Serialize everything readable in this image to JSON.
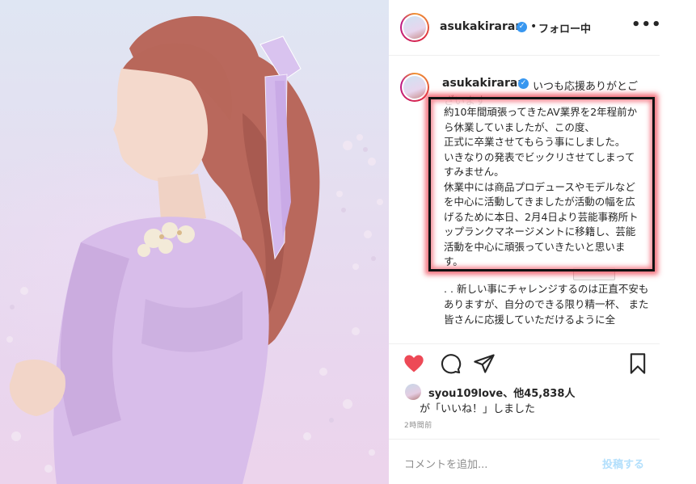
{
  "post": {
    "username": "asukakiraran",
    "verified_mark": "✓",
    "follow_separator": "•",
    "follow_status": "フォロー中",
    "more_label": "•••"
  },
  "caption": {
    "username": "asukakiraran",
    "first_line": "いつも応援ありがとご",
    "first_line_cont": "ざいます",
    "highlighted_lines": [
      "約10年間頑張ってきたAV業界を2年程前か",
      "ら休業していましたが、この度、",
      "正式に卒業させてもらう事にしました。",
      "いきなりの発表でビックリさせてしまって",
      "すみません。",
      "休業中には商品プロデュースやモデルなど",
      "を中心に活動してきましたが活動の幅を広",
      "げるために本日、2月4日より芸能事務所ト",
      "ップランクマネージメントに移籍し、芸能",
      "活動を中心に頑張っていきたいと思いま",
      "す。"
    ],
    "lower_lines": [
      ".",
      ".",
      "新しい事にチャレンジするのは正直不安も",
      "ありますが、自分のできる限り精一杯、",
      "また皆さんに応援していただけるように全"
    ]
  },
  "actions": {
    "like_icon": "heart-icon",
    "comment_icon": "comment-icon",
    "share_icon": "share-icon",
    "save_icon": "bookmark-icon",
    "like_color": "#ed4956"
  },
  "likes": {
    "user": "syou109love、他45,838人",
    "suffix": "が「いいね！」しました"
  },
  "timestamp": "2時間前",
  "comment": {
    "placeholder": "コメントを追加...",
    "post_label": "投稿する"
  }
}
